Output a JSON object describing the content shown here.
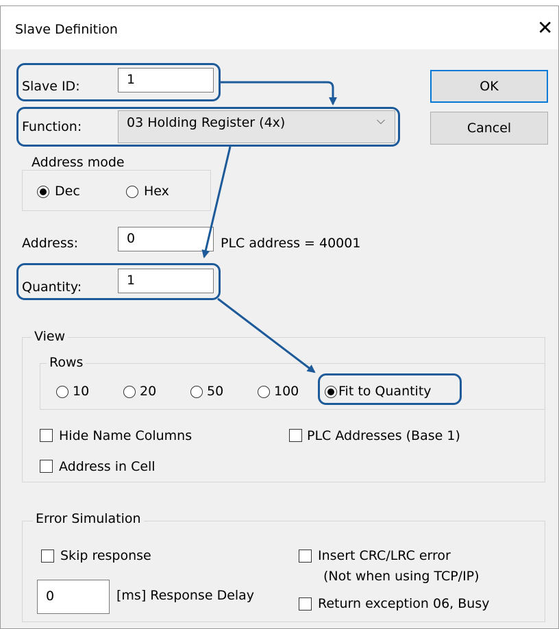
{
  "window": {
    "title": "Slave Definition",
    "close_icon": "close-icon"
  },
  "slave_id": {
    "label": "Slave ID:",
    "value": "1"
  },
  "function": {
    "label": "Function:",
    "selected": "03 Holding Register (4x)"
  },
  "buttons": {
    "ok": "OK",
    "cancel": "Cancel"
  },
  "address_mode": {
    "legend": "Address mode",
    "dec": "Dec",
    "hex": "Hex",
    "selected": "Dec"
  },
  "address": {
    "label": "Address:",
    "value": "0",
    "plc_address": "PLC address = 40001"
  },
  "quantity": {
    "label": "Quantity:",
    "value": "1"
  },
  "view": {
    "legend": "View",
    "rows": {
      "legend": "Rows",
      "options": [
        "10",
        "20",
        "50",
        "100",
        "Fit to Quantity"
      ],
      "selected": "Fit to Quantity"
    },
    "hide_name_columns": {
      "label": "Hide Name Columns",
      "checked": false
    },
    "plc_addresses": {
      "label": "PLC Addresses (Base 1)",
      "checked": false
    },
    "address_in_cell": {
      "label": "Address in Cell",
      "checked": false
    }
  },
  "error_simulation": {
    "legend": "Error Simulation",
    "skip_response": {
      "label": "Skip response",
      "checked": false
    },
    "insert_crc": {
      "label": "Insert CRC/LRC error",
      "note": "(Not when using TCP/IP)",
      "checked": false
    },
    "response_delay": {
      "value": "0",
      "label": "[ms] Response Delay"
    },
    "return_exception": {
      "label": "Return exception 06, Busy",
      "checked": false
    }
  },
  "colors": {
    "annotation": "#1d5a99",
    "default_button_border": "#0078d7",
    "background": "#f0f0f0"
  }
}
